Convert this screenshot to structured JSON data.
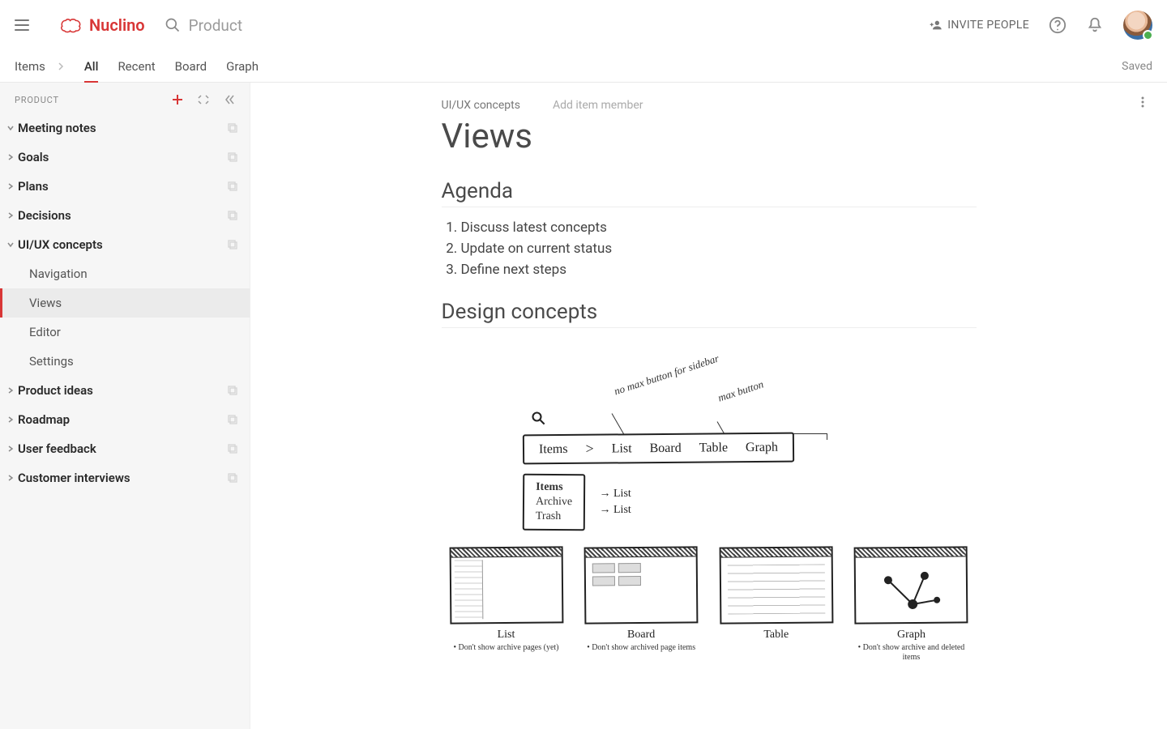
{
  "brand": "Nuclino",
  "search_placeholder": "Product",
  "invite_label": "INVITE PEOPLE",
  "breadcrumb": "Items",
  "tabs": {
    "all": "All",
    "recent": "Recent",
    "board": "Board",
    "graph": "Graph"
  },
  "saved_label": "Saved",
  "sidebar": {
    "title": "PRODUCT",
    "items": [
      {
        "label": "Meeting notes",
        "expanded": true,
        "bold": true
      },
      {
        "label": "Goals",
        "bold": true
      },
      {
        "label": "Plans",
        "bold": true
      },
      {
        "label": "Decisions",
        "bold": true
      },
      {
        "label": "UI/UX concepts",
        "expanded": true,
        "bold": true,
        "children": [
          {
            "label": "Navigation"
          },
          {
            "label": "Views",
            "selected": true
          },
          {
            "label": "Editor"
          },
          {
            "label": "Settings"
          }
        ]
      },
      {
        "label": "Product ideas",
        "bold": true
      },
      {
        "label": "Roadmap",
        "bold": true
      },
      {
        "label": "User feedback",
        "bold": true
      },
      {
        "label": "Customer interviews",
        "bold": true
      }
    ]
  },
  "doc": {
    "parent": "UI/UX concepts",
    "add_member": "Add item member",
    "title": "Views",
    "agenda_heading": "Agenda",
    "agenda": [
      "Discuss latest concepts",
      "Update on current status",
      "Define next steps"
    ],
    "concepts_heading": "Design concepts"
  },
  "sketch": {
    "tabs": [
      "Items",
      "List",
      "Board",
      "Table",
      "Graph"
    ],
    "annot1": "no max button for sidebar",
    "annot2": "max button",
    "dropdown": [
      "Items",
      "Archive",
      "Trash"
    ],
    "dd_right": [
      "→ List",
      "→ List"
    ],
    "thumbs": [
      {
        "title": "List",
        "note": "• Don't show archive pages (yet)"
      },
      {
        "title": "Board",
        "note": "• Don't show archived page items"
      },
      {
        "title": "Table",
        "note": ""
      },
      {
        "title": "Graph",
        "note": "• Don't show archive and deleted items"
      }
    ]
  }
}
